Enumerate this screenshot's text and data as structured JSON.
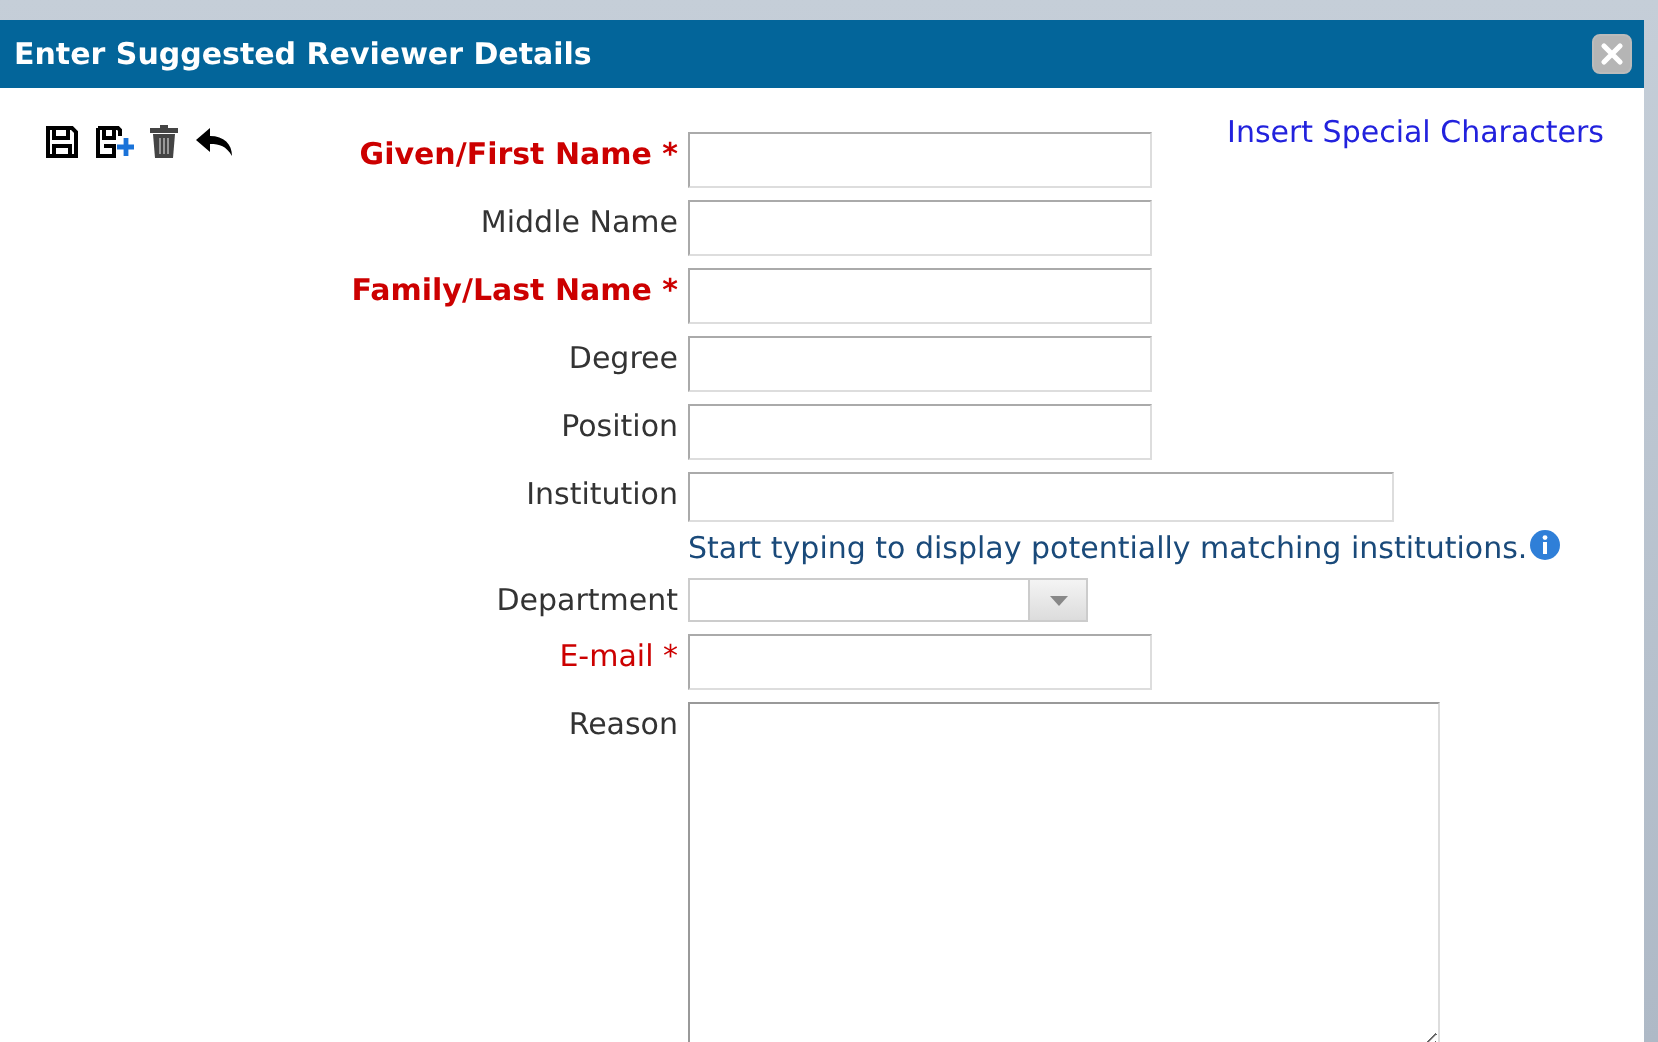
{
  "window": {
    "title": "Enter Suggested Reviewer Details"
  },
  "toolbar": {
    "link": "Insert Special Characters"
  },
  "fields": [
    {
      "label": "Given/First Name *",
      "required": true,
      "strong": true,
      "kind": "text"
    },
    {
      "label": "Middle Name",
      "required": false,
      "strong": false,
      "kind": "text"
    },
    {
      "label": "Family/Last Name *",
      "required": true,
      "strong": true,
      "kind": "text"
    },
    {
      "label": "Degree",
      "required": false,
      "strong": false,
      "kind": "text"
    },
    {
      "label": "Position",
      "required": false,
      "strong": false,
      "kind": "text"
    },
    {
      "label": "Institution",
      "required": false,
      "strong": false,
      "kind": "wide-text",
      "hint": "Start typing to display potentially matching institutions."
    },
    {
      "label": "Department",
      "required": false,
      "strong": false,
      "kind": "select"
    },
    {
      "label": "E-mail *",
      "required": true,
      "strong": false,
      "kind": "text"
    },
    {
      "label": "Reason",
      "required": false,
      "strong": false,
      "kind": "textarea"
    }
  ]
}
